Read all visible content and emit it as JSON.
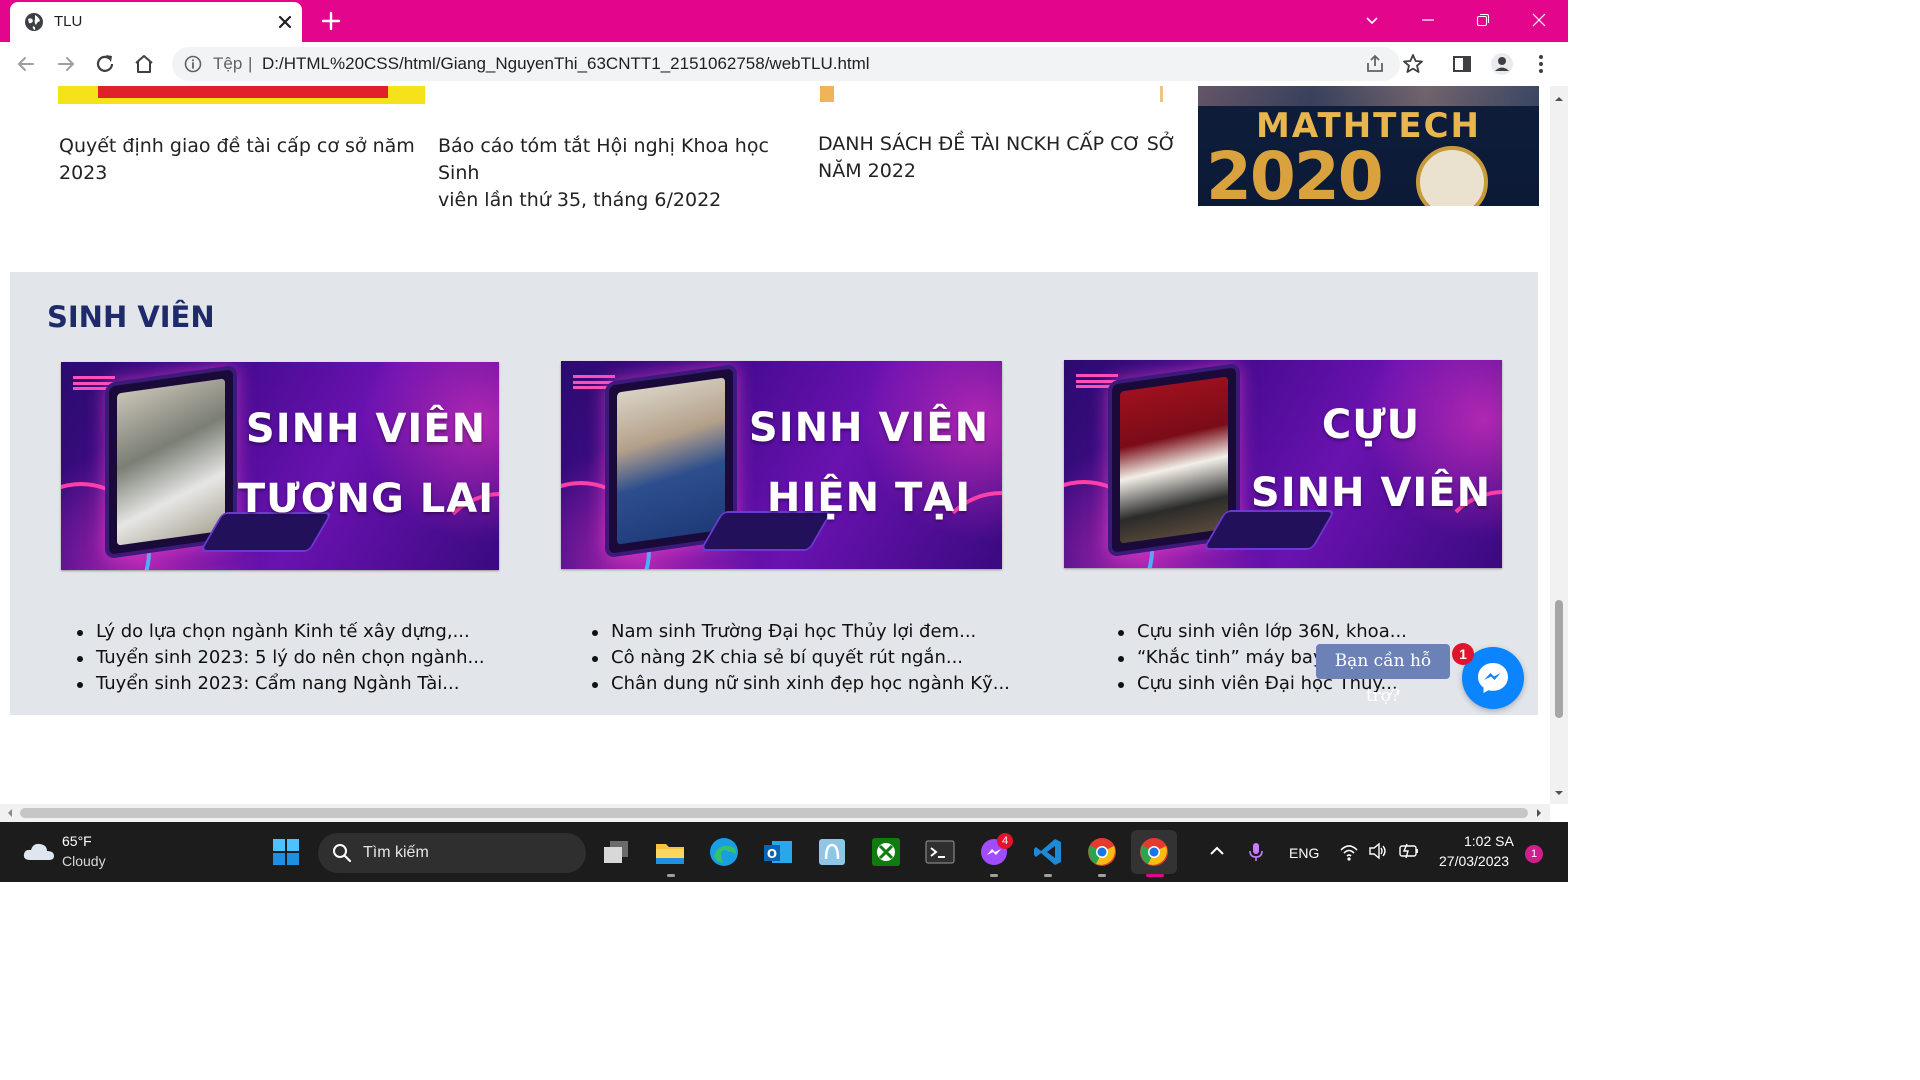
{
  "browser": {
    "tab_title": "TLU",
    "scheme_label": "Tệp",
    "separator": "|",
    "url": "D:/HTML%20CSS/html/Giang_NguyenThi_63CNTT1_2151062758/webTLU.html"
  },
  "news": {
    "items": [
      {
        "title_line1": "Quyết định giao đề tài cấp cơ sở năm 2023",
        "title_line2": ""
      },
      {
        "title_line1": "Báo cáo tóm tắt Hội nghị Khoa học Sinh",
        "title_line2": "viên lần thứ 35, tháng 6/2022"
      },
      {
        "title_line1": "DANH SÁCH ĐỀ TÀI NCKH CẤP CƠ SỞ",
        "title_line2": "NĂM 2022"
      }
    ],
    "mathtech": {
      "word": "MATHTECH",
      "year": "2020"
    }
  },
  "students": {
    "heading": "SINH VIÊN",
    "cards": [
      {
        "banner_line1": "SINH VIÊN",
        "banner_line2": "TƯƠNG LAI",
        "links": [
          "Lý do lựa chọn ngành Kinh tế xây dựng,...",
          "Tuyển sinh 2023: 5 lý do nên chọn ngành...",
          "Tuyển sinh 2023: Cẩm nang Ngành Tài..."
        ]
      },
      {
        "banner_line1": "SINH VIÊN",
        "banner_line2": "HIỆN TẠI",
        "links": [
          "Nam sinh Trường Đại học Thủy lợi đem...",
          "Cô nàng 2K chia sẻ bí quyết rút ngắn...",
          "Chân dung nữ sinh xinh đẹp học ngành Kỹ..."
        ]
      },
      {
        "banner_line1": "CỰU",
        "banner_line2": "SINH VIÊN",
        "links": [
          "Cựu sinh viên lớp 36N, khoa...",
          "“Khắc tinh” máy bay Mỹ",
          "Cựu sinh viên Đại học Thủy..."
        ]
      }
    ]
  },
  "support": {
    "bubble_text": "Bạn cần hỗ trợ?",
    "badge_count": "1"
  },
  "taskbar": {
    "temperature": "65°F",
    "condition": "Cloudy",
    "search_placeholder": "Tìm kiếm",
    "messenger_badge": "4",
    "language": "ENG",
    "time": "1:02 SA",
    "date": "27/03/2023",
    "notification_count": "1"
  },
  "colors": {
    "tab_strip": "#e3068d",
    "section_bg": "#e2e5ea",
    "heading": "#1f2a6b",
    "support_bubble": "#6c82b7",
    "messenger_blue": "#0a84ff"
  },
  "icons": {
    "tab": "globe-icon",
    "toolbar": [
      "back-icon",
      "forward-icon",
      "reload-icon",
      "home-icon",
      "info-icon",
      "share-icon",
      "star-icon",
      "side-panel-icon",
      "profile-icon",
      "menu-icon"
    ],
    "taskbar": [
      "weather-cloud-icon",
      "windows-start-icon",
      "search-icon",
      "task-view-icon",
      "file-explorer-icon",
      "edge-icon",
      "outlook-icon",
      "app-icon",
      "xbox-icon",
      "terminal-icon",
      "messenger-icon",
      "vscode-icon",
      "chrome-icon",
      "chrome-icon",
      "chevron-up-icon",
      "microphone-icon",
      "wifi-icon",
      "volume-icon",
      "battery-icon"
    ]
  }
}
